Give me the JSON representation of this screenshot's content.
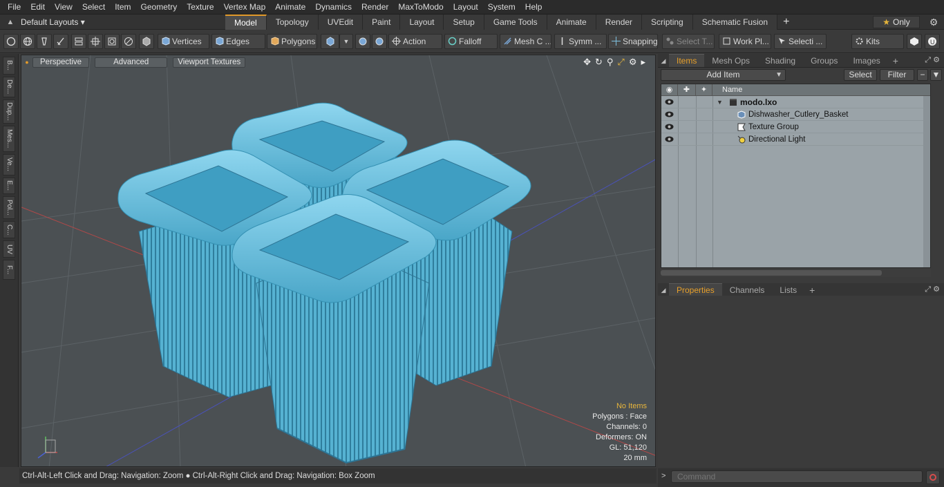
{
  "menubar": {
    "items": [
      "File",
      "Edit",
      "View",
      "Select",
      "Item",
      "Geometry",
      "Texture",
      "Vertex Map",
      "Animate",
      "Dynamics",
      "Render",
      "MaxToModo",
      "Layout",
      "System",
      "Help"
    ]
  },
  "layout_bar": {
    "layouts_label": "Default Layouts",
    "tabs": [
      "Model",
      "Topology",
      "UVEdit",
      "Paint",
      "Layout",
      "Setup",
      "Game Tools",
      "Animate",
      "Render",
      "Scripting",
      "Schematic Fusion"
    ],
    "active_tab": "Model",
    "plus": "+",
    "only_label": "Only"
  },
  "toolbar": {
    "vertices": "Vertices",
    "edges": "Edges",
    "polygons": "Polygons",
    "action": "Action",
    "falloff": "Falloff",
    "mesh_c": "Mesh C ...",
    "symm": "Symm ...",
    "snapping": "Snapping",
    "select_t": "Select T...",
    "work_pl": "Work Pl...",
    "selecti": "Selecti ...",
    "kits": "Kits"
  },
  "left_tabs": [
    "B...",
    "De...",
    "Dup...",
    "Mes...",
    "Ve...",
    "E...",
    "Pol...",
    "C...",
    "UV",
    "F..."
  ],
  "viewport": {
    "perspective": "Perspective",
    "advanced": "Advanced",
    "viewport_textures": "Viewport Textures",
    "info": {
      "no_items": "No Items",
      "polygons": "Polygons : Face",
      "channels": "Channels: 0",
      "deformers": "Deformers: ON",
      "gl": "GL: 51,120",
      "scale": "20 mm"
    },
    "model_color": "#5ab8d8"
  },
  "items_panel": {
    "tabs": [
      "Items",
      "Mesh Ops",
      "Shading",
      "Groups",
      "Images"
    ],
    "active_tab": "Items",
    "add_item": "Add Item",
    "select": "Select",
    "filter": "Filter",
    "name_header": "Name",
    "rows": [
      {
        "label": "modo.lxo",
        "icon": "scene-icon"
      },
      {
        "label": "Dishwasher_Cutlery_Basket",
        "icon": "mesh-icon"
      },
      {
        "label": "Texture Group",
        "icon": "texture-group-icon"
      },
      {
        "label": "Directional Light",
        "icon": "light-icon"
      }
    ]
  },
  "properties_panel": {
    "tabs": [
      "Properties",
      "Channels",
      "Lists"
    ],
    "active_tab": "Properties"
  },
  "status": {
    "text": "Ctrl-Alt-Left Click and Drag: Navigation: Zoom ● Ctrl-Alt-Right Click and Drag: Navigation: Box Zoom"
  },
  "command": {
    "placeholder": "Command"
  },
  "colors": {
    "accent": "#e29a2a",
    "basket": "#5ab8d8"
  }
}
